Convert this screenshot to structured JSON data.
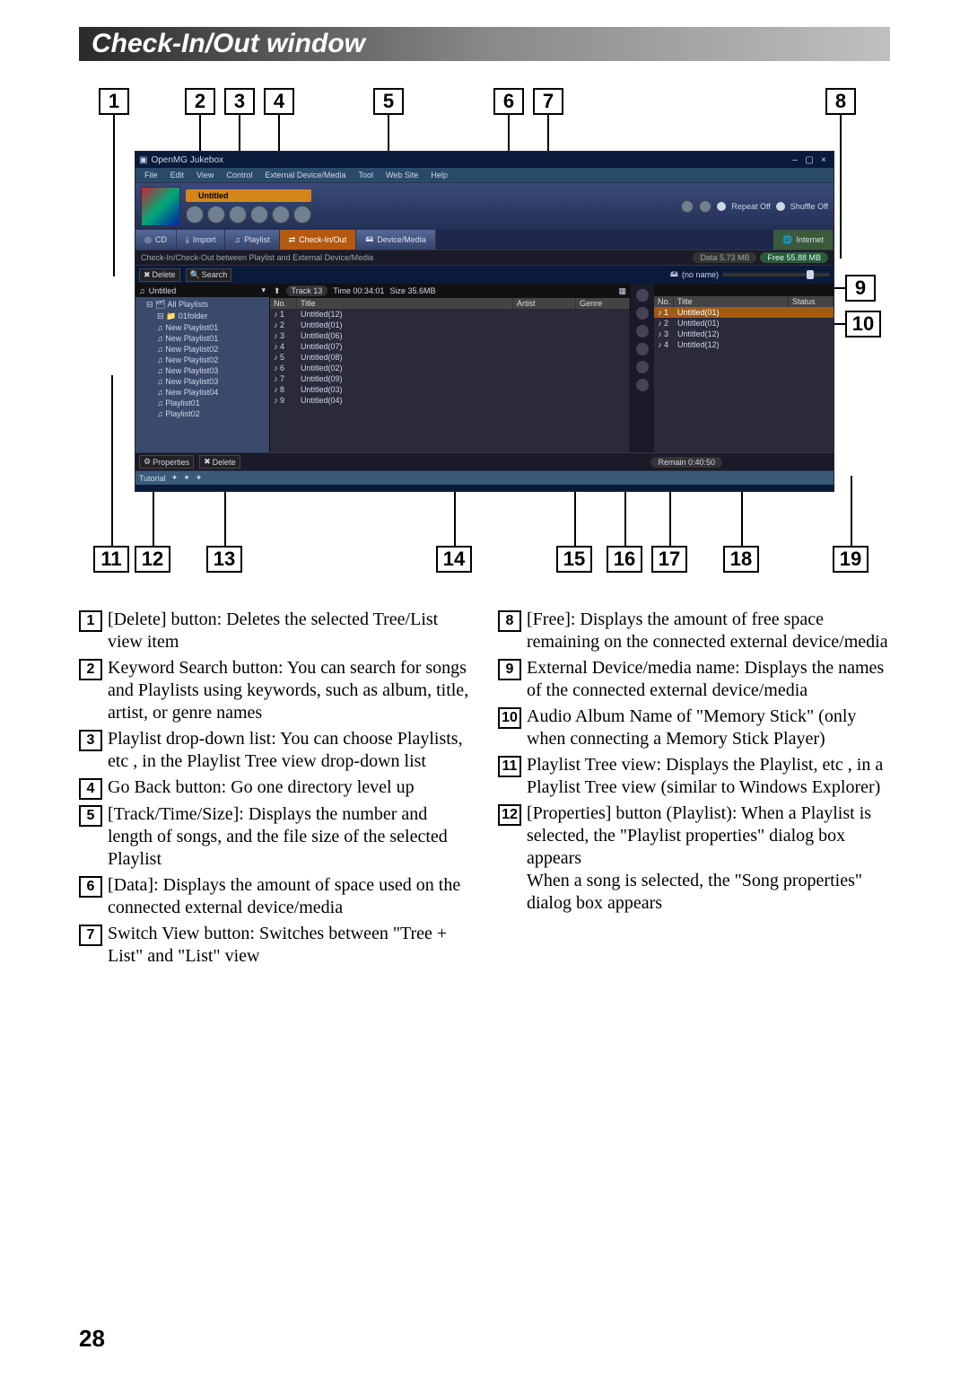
{
  "heading": "Check-In/Out window",
  "page_number": "28",
  "callouts_top": [
    "1",
    "2",
    "3",
    "4",
    "5",
    "6",
    "7",
    "8"
  ],
  "callouts_side": [
    "9",
    "10"
  ],
  "callouts_bottom": [
    "11",
    "12",
    "13",
    "14",
    "15",
    "16",
    "17",
    "18",
    "19"
  ],
  "app": {
    "title": "OpenMG Jukebox",
    "menus": [
      "File",
      "Edit",
      "View",
      "Control",
      "External Device/Media",
      "Tool",
      "Web Site",
      "Help"
    ],
    "now_playing_chip": "Untitled",
    "repeat": "Repeat Off",
    "shuffle": "Shuffle Off",
    "mode_buttons": {
      "cd": "CD",
      "import": "Import",
      "playlist": "Playlist",
      "checkinout": "Check-In/Out",
      "devicemedia": "Device/Media",
      "internet": "Internet"
    },
    "substatus_left": "Check-In/Check-Out between Playlist and External Device/Media",
    "substatus_data": "Data 5.73 MB",
    "substatus_free": "Free 55.88 MB",
    "action_delete": "Delete",
    "action_search": "Search",
    "device_name": "(no name)",
    "playlist_dropdown_label": "Untitled",
    "track_time_size": {
      "track": "Track 13",
      "time": "Time 00:34:01",
      "size": "Size 35.6MB"
    },
    "tree": {
      "root": "All Playlists",
      "items": [
        "01folder",
        "New Playlist01",
        "New Playlist01",
        "New Playlist02",
        "New Playlist02",
        "New Playlist03",
        "New Playlist03",
        "New Playlist04",
        "Playlist01",
        "Playlist02"
      ]
    },
    "list_cols": [
      "No.",
      "Title",
      "Artist",
      "Genre"
    ],
    "list_rows": [
      {
        "no": "1",
        "title": "Untitled(12)"
      },
      {
        "no": "2",
        "title": "Untitled(01)"
      },
      {
        "no": "3",
        "title": "Untitled(06)"
      },
      {
        "no": "4",
        "title": "Untitled(07)"
      },
      {
        "no": "5",
        "title": "Untitled(08)"
      },
      {
        "no": "6",
        "title": "Untitled(02)"
      },
      {
        "no": "7",
        "title": "Untitled(09)"
      },
      {
        "no": "8",
        "title": "Untitled(03)"
      },
      {
        "no": "9",
        "title": "Untitled(04)"
      }
    ],
    "device_cols": [
      "No.",
      "Title",
      "Status"
    ],
    "device_rows": [
      {
        "no": "1",
        "title": "Untitled(01)"
      },
      {
        "no": "2",
        "title": "Untitled(01)"
      },
      {
        "no": "3",
        "title": "Untitled(12)"
      },
      {
        "no": "4",
        "title": "Untitled(12)"
      }
    ],
    "footer_properties": "Properties",
    "footer_delete": "Delete",
    "footer_remain": "Remain 0:40:50",
    "tutorial": "Tutorial"
  },
  "explanations_left": [
    {
      "n": "1",
      "text": "[Delete] button: Deletes the selected Tree/List view item"
    },
    {
      "n": "2",
      "text": "Keyword Search button: You can search for songs and Playlists using keywords, such as album, title, artist, or genre names"
    },
    {
      "n": "3",
      "text": "Playlist drop-down list: You can choose Playlists, etc , in the Playlist Tree view drop-down list"
    },
    {
      "n": "4",
      "text": "Go Back button: Go one directory level up"
    },
    {
      "n": "5",
      "text": "[Track/Time/Size]: Displays the number and length of songs, and the file size of the selected Playlist"
    },
    {
      "n": "6",
      "text": "[Data]: Displays the amount of space used on the connected external device/media"
    },
    {
      "n": "7",
      "text": "Switch View button: Switches between \"Tree + List\" and \"List\" view"
    }
  ],
  "explanations_right": [
    {
      "n": "8",
      "text": "[Free]: Displays the amount of free space remaining on the connected external device/media"
    },
    {
      "n": "9",
      "text": "External Device/media name: Displays the names of the connected external device/media"
    },
    {
      "n": "10",
      "text": "Audio Album Name of \"Memory Stick\" (only when connecting a Memory Stick Player)"
    },
    {
      "n": "11",
      "text": "Playlist Tree view: Displays the Playlist, etc , in a Playlist Tree view (similar to Windows Explorer)"
    },
    {
      "n": "12",
      "text": "[Properties] button (Playlist): When a Playlist is selected, the \"Playlist properties\" dialog box appears\nWhen a song is selected, the \"Song properties\" dialog box appears"
    }
  ]
}
